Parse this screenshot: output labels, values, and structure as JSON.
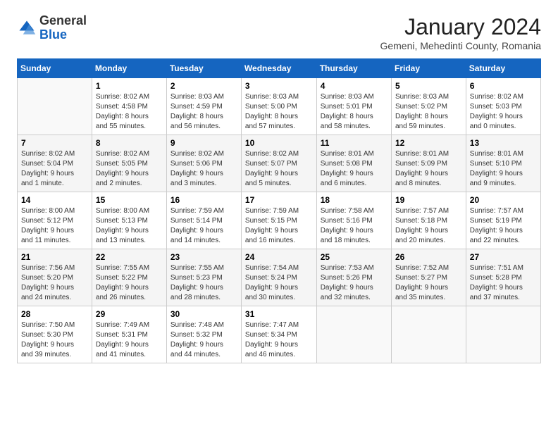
{
  "header": {
    "logo_general": "General",
    "logo_blue": "Blue",
    "month_title": "January 2024",
    "location": "Gemeni, Mehedinti County, Romania"
  },
  "days_of_week": [
    "Sunday",
    "Monday",
    "Tuesday",
    "Wednesday",
    "Thursday",
    "Friday",
    "Saturday"
  ],
  "weeks": [
    [
      {
        "day": "",
        "info": ""
      },
      {
        "day": "1",
        "info": "Sunrise: 8:02 AM\nSunset: 4:58 PM\nDaylight: 8 hours\nand 55 minutes."
      },
      {
        "day": "2",
        "info": "Sunrise: 8:03 AM\nSunset: 4:59 PM\nDaylight: 8 hours\nand 56 minutes."
      },
      {
        "day": "3",
        "info": "Sunrise: 8:03 AM\nSunset: 5:00 PM\nDaylight: 8 hours\nand 57 minutes."
      },
      {
        "day": "4",
        "info": "Sunrise: 8:03 AM\nSunset: 5:01 PM\nDaylight: 8 hours\nand 58 minutes."
      },
      {
        "day": "5",
        "info": "Sunrise: 8:03 AM\nSunset: 5:02 PM\nDaylight: 8 hours\nand 59 minutes."
      },
      {
        "day": "6",
        "info": "Sunrise: 8:02 AM\nSunset: 5:03 PM\nDaylight: 9 hours\nand 0 minutes."
      }
    ],
    [
      {
        "day": "7",
        "info": "Sunrise: 8:02 AM\nSunset: 5:04 PM\nDaylight: 9 hours\nand 1 minute."
      },
      {
        "day": "8",
        "info": "Sunrise: 8:02 AM\nSunset: 5:05 PM\nDaylight: 9 hours\nand 2 minutes."
      },
      {
        "day": "9",
        "info": "Sunrise: 8:02 AM\nSunset: 5:06 PM\nDaylight: 9 hours\nand 3 minutes."
      },
      {
        "day": "10",
        "info": "Sunrise: 8:02 AM\nSunset: 5:07 PM\nDaylight: 9 hours\nand 5 minutes."
      },
      {
        "day": "11",
        "info": "Sunrise: 8:01 AM\nSunset: 5:08 PM\nDaylight: 9 hours\nand 6 minutes."
      },
      {
        "day": "12",
        "info": "Sunrise: 8:01 AM\nSunset: 5:09 PM\nDaylight: 9 hours\nand 8 minutes."
      },
      {
        "day": "13",
        "info": "Sunrise: 8:01 AM\nSunset: 5:10 PM\nDaylight: 9 hours\nand 9 minutes."
      }
    ],
    [
      {
        "day": "14",
        "info": "Sunrise: 8:00 AM\nSunset: 5:12 PM\nDaylight: 9 hours\nand 11 minutes."
      },
      {
        "day": "15",
        "info": "Sunrise: 8:00 AM\nSunset: 5:13 PM\nDaylight: 9 hours\nand 13 minutes."
      },
      {
        "day": "16",
        "info": "Sunrise: 7:59 AM\nSunset: 5:14 PM\nDaylight: 9 hours\nand 14 minutes."
      },
      {
        "day": "17",
        "info": "Sunrise: 7:59 AM\nSunset: 5:15 PM\nDaylight: 9 hours\nand 16 minutes."
      },
      {
        "day": "18",
        "info": "Sunrise: 7:58 AM\nSunset: 5:16 PM\nDaylight: 9 hours\nand 18 minutes."
      },
      {
        "day": "19",
        "info": "Sunrise: 7:57 AM\nSunset: 5:18 PM\nDaylight: 9 hours\nand 20 minutes."
      },
      {
        "day": "20",
        "info": "Sunrise: 7:57 AM\nSunset: 5:19 PM\nDaylight: 9 hours\nand 22 minutes."
      }
    ],
    [
      {
        "day": "21",
        "info": "Sunrise: 7:56 AM\nSunset: 5:20 PM\nDaylight: 9 hours\nand 24 minutes."
      },
      {
        "day": "22",
        "info": "Sunrise: 7:55 AM\nSunset: 5:22 PM\nDaylight: 9 hours\nand 26 minutes."
      },
      {
        "day": "23",
        "info": "Sunrise: 7:55 AM\nSunset: 5:23 PM\nDaylight: 9 hours\nand 28 minutes."
      },
      {
        "day": "24",
        "info": "Sunrise: 7:54 AM\nSunset: 5:24 PM\nDaylight: 9 hours\nand 30 minutes."
      },
      {
        "day": "25",
        "info": "Sunrise: 7:53 AM\nSunset: 5:26 PM\nDaylight: 9 hours\nand 32 minutes."
      },
      {
        "day": "26",
        "info": "Sunrise: 7:52 AM\nSunset: 5:27 PM\nDaylight: 9 hours\nand 35 minutes."
      },
      {
        "day": "27",
        "info": "Sunrise: 7:51 AM\nSunset: 5:28 PM\nDaylight: 9 hours\nand 37 minutes."
      }
    ],
    [
      {
        "day": "28",
        "info": "Sunrise: 7:50 AM\nSunset: 5:30 PM\nDaylight: 9 hours\nand 39 minutes."
      },
      {
        "day": "29",
        "info": "Sunrise: 7:49 AM\nSunset: 5:31 PM\nDaylight: 9 hours\nand 41 minutes."
      },
      {
        "day": "30",
        "info": "Sunrise: 7:48 AM\nSunset: 5:32 PM\nDaylight: 9 hours\nand 44 minutes."
      },
      {
        "day": "31",
        "info": "Sunrise: 7:47 AM\nSunset: 5:34 PM\nDaylight: 9 hours\nand 46 minutes."
      },
      {
        "day": "",
        "info": ""
      },
      {
        "day": "",
        "info": ""
      },
      {
        "day": "",
        "info": ""
      }
    ]
  ]
}
